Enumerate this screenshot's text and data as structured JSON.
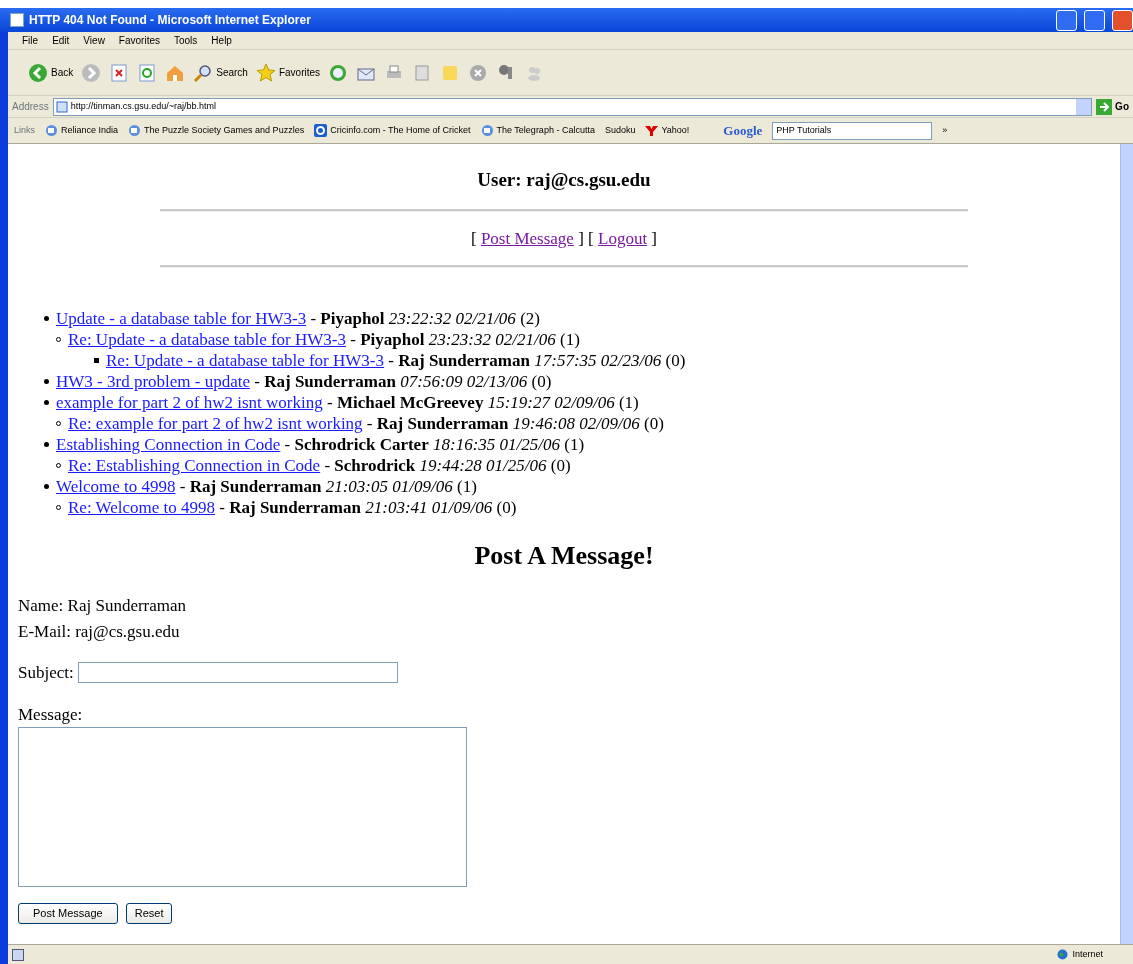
{
  "window": {
    "title": "HTTP 404 Not Found - Microsoft Internet Explorer"
  },
  "menu": [
    "File",
    "Edit",
    "View",
    "Favorites",
    "Tools",
    "Help"
  ],
  "toolbar": [
    {
      "kind": "back",
      "label": "Back"
    },
    {
      "kind": "forward"
    },
    {
      "kind": "stop"
    },
    {
      "kind": "refresh"
    },
    {
      "kind": "home"
    },
    {
      "kind": "search",
      "label": "Search"
    },
    {
      "kind": "favorites",
      "label": "Favorites"
    },
    {
      "kind": "history"
    },
    {
      "kind": "mail"
    },
    {
      "kind": "print"
    },
    {
      "kind": "edit"
    },
    {
      "kind": "note"
    },
    {
      "kind": "block"
    },
    {
      "kind": "messenger"
    },
    {
      "kind": "contacts"
    }
  ],
  "address": {
    "label": "Address",
    "value": "http://tinman.cs.gsu.edu/~raj/bb.html",
    "go": "Go"
  },
  "links_bar": {
    "label": "Links",
    "items": [
      {
        "kind": "page",
        "label": "Reliance India"
      },
      {
        "kind": "page",
        "label": "The Puzzle Society Games and Puzzles"
      },
      {
        "kind": "cricinfo",
        "label": "Cricinfo.com - The Home of Cricket"
      },
      {
        "kind": "page",
        "label": "The Telegraph - Calcutta"
      },
      {
        "kind": "none",
        "label": "Sudoku"
      },
      {
        "kind": "yahoo",
        "label": "Yahoo!"
      }
    ],
    "search_brand": "Google",
    "search_value": "PHP Tutorials",
    "more": "»"
  },
  "page": {
    "user": "User: raj@cs.gsu.edu",
    "nav": [
      {
        "open": "[",
        "label": "Post Message",
        "close": "]",
        "visited": true
      },
      {
        "open": "[",
        "label": "Logout",
        "close": "]",
        "visited": true
      }
    ],
    "threads": [
      {
        "subject": "Update - a database table for HW3-3",
        "visited": false,
        "details": " - **Piyaphol** *23:22:32 02/21/06* (2)",
        "children": [
          {
            "subject": "Re: Update - a database table for HW3-3",
            "visited": false,
            "details": " - **Piyaphol** *23:23:32 02/21/06* (1)",
            "children": [
              {
                "subject": "Re: Update - a database table for HW3-3",
                "visited": false,
                "details": " - **Raj Sunderraman** *17:57:35 02/23/06* (0)"
              }
            ]
          }
        ]
      },
      {
        "subject": "HW3 - 3rd problem - update",
        "visited": false,
        "details": " - **Raj Sunderraman** *07:56:09 02/13/06* (0)"
      },
      {
        "subject": "example for part 2 of hw2 isnt working",
        "visited": false,
        "details": " - **Michael McGreevey** *15:19:27 02/09/06* (1)",
        "children": [
          {
            "subject": "Re: example for part 2 of hw2 isnt working",
            "visited": false,
            "details": " - **Raj Sunderraman** *19:46:08 02/09/06* (0)"
          }
        ]
      },
      {
        "subject": "Establishing Connection in Code",
        "visited": false,
        "details": " - **Schrodrick Carter** *18:16:35 01/25/06* (1)",
        "children": [
          {
            "subject": "Re: Establishing Connection in Code",
            "visited": false,
            "details": " - **Schrodrick** *19:44:28 01/25/06* (0)"
          }
        ]
      },
      {
        "subject": "Welcome to 4998",
        "visited": false,
        "details": " - **Raj Sunderraman** *21:03:05 01/09/06* (1)",
        "children": [
          {
            "subject": "Re: Welcome to 4998",
            "visited": false,
            "details": " - **Raj Sunderraman** *21:03:41 01/09/06* (0)"
          }
        ]
      }
    ],
    "form": {
      "heading": "Post A Message!",
      "name": "Name: Raj Sunderraman",
      "email": "E-Mail: raj@cs.gsu.edu",
      "subject_label": "Subject:",
      "message_label": "Message:",
      "buttons": [
        "Post Message",
        "Reset"
      ]
    }
  },
  "status_bar": {
    "zone": "Internet"
  }
}
